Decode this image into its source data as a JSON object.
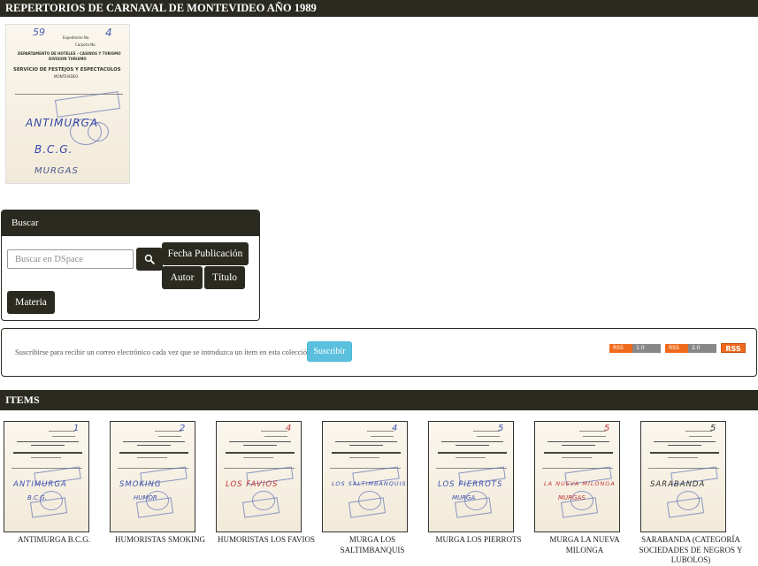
{
  "collection": {
    "title": "REPERTORIOS DE CARNAVAL DE MONTEVIDEO AÑO 1989"
  },
  "cover": {
    "top_number": "59",
    "field_expediente": "Expediente No.",
    "field_carpeta": "Carpeta No.",
    "dept": "DEPARTAMENTO DE HOTELES - CASINOS Y TURISMO",
    "division": "DIVISION TURISMO",
    "service": "SERVICIO DE FESTEJOS Y ESPECTACULOS",
    "city": "MONTEVIDEO",
    "handwriting_1": "ANTIMURGA",
    "handwriting_2": "B.C.G.",
    "handwriting_3": "MURGAS"
  },
  "search": {
    "header": "Buscar",
    "placeholder": "Buscar en DSpace",
    "btn_fecha": "Fecha Publicación",
    "btn_autor": "Autor",
    "btn_titulo": "Título",
    "btn_materia": "Materia",
    "search_icon": "search-icon"
  },
  "subscription": {
    "text": "Suscribirse para recibir un correo electrónico cada vez que se introduzca un ítem en esta colección.",
    "button": "Suscribir",
    "rss1_left": "RSS",
    "rss1_right": "1.0",
    "rss2_left": "RSS",
    "rss2_right": "2.0",
    "rss_solid": "RSS"
  },
  "items_header": "ITEMS",
  "items": [
    {
      "caption": "ANTIMURGA B.C.G.",
      "hand": "ANTIMURGA",
      "hand2": "B.C.G.",
      "num": "1",
      "ink": "blue"
    },
    {
      "caption": "HUMORISTAS SMOKING",
      "hand": "SMOKING",
      "hand2": "HUMOR",
      "num": "2",
      "ink": "blue"
    },
    {
      "caption": "HUMORISTAS LOS FAVIOS",
      "hand": "LOS FAVIOS",
      "hand2": "",
      "num": "4",
      "ink": "red"
    },
    {
      "caption": "MURGA LOS SALTIMBANQUIS",
      "hand": "LOS SALTIMBANQUIS",
      "hand2": "",
      "num": "4",
      "ink": "blue"
    },
    {
      "caption": "MURGA LOS PIERROTS",
      "hand": "LOS PIERROTS",
      "hand2": "MURGA",
      "num": "5",
      "ink": "blue"
    },
    {
      "caption": "MURGA LA NUEVA MILONGA",
      "hand": "LA NUEVA MILONGA",
      "hand2": "MURGAS",
      "num": "5",
      "ink": "red"
    },
    {
      "caption": "SARABANDA (CATEGORÍA SOCIEDADES DE NEGROS Y LUBOLOS)",
      "hand": "SARABANDA",
      "hand2": "",
      "num": "5",
      "ink": "dark"
    }
  ]
}
